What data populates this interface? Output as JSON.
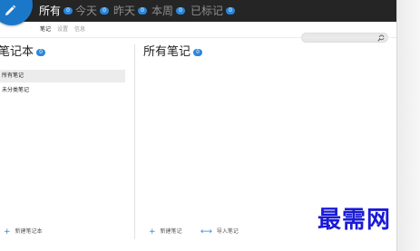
{
  "filters": [
    {
      "label": "所有",
      "count": "0",
      "active": true
    },
    {
      "label": "今天",
      "count": "0",
      "active": false
    },
    {
      "label": "昨天",
      "count": "0",
      "active": false
    },
    {
      "label": "本周",
      "count": "0",
      "active": false
    },
    {
      "label": "已标记",
      "count": "0",
      "active": false
    }
  ],
  "subtabs": [
    {
      "label": "笔记",
      "active": true
    },
    {
      "label": "设置",
      "active": false
    },
    {
      "label": "信息",
      "active": false
    }
  ],
  "search": {
    "placeholder": "",
    "value": "",
    "icon": "search-icon"
  },
  "notebooks": {
    "title": "笔记本",
    "count": "0",
    "items": [
      {
        "label": "所有笔记",
        "selected": true
      },
      {
        "label": "未分类笔记",
        "selected": false
      }
    ],
    "add_label": "新建笔记本"
  },
  "notes": {
    "title": "所有笔记",
    "count": "0",
    "new_label": "新建笔记",
    "import_label": "导入笔记"
  },
  "watermark": "最需网",
  "colors": {
    "accent": "#2b86d9",
    "topbar": "#252525",
    "logo": "#1b78c9",
    "watermark": "#1a1ad6"
  }
}
